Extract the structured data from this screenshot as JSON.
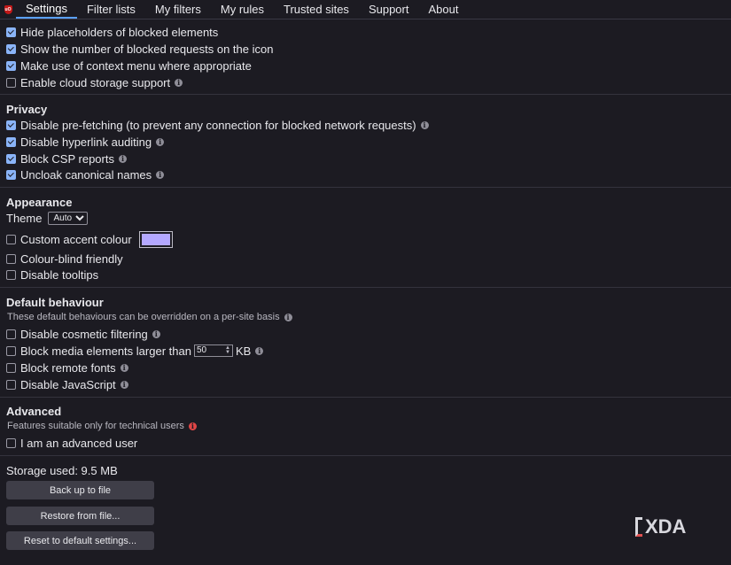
{
  "tabs": [
    "Settings",
    "Filter lists",
    "My filters",
    "My rules",
    "Trusted sites",
    "Support",
    "About"
  ],
  "active_tab": "Settings",
  "logo_text": "uO",
  "general": {
    "hide_placeholders": "Hide placeholders of blocked elements",
    "show_count": "Show the number of blocked requests on the icon",
    "context_menu": "Make use of context menu where appropriate",
    "cloud_storage": "Enable cloud storage support"
  },
  "privacy": {
    "title": "Privacy",
    "prefetch": "Disable pre-fetching (to prevent any connection for blocked network requests)",
    "hyperlink": "Disable hyperlink auditing",
    "csp": "Block CSP reports",
    "uncloak": "Uncloak canonical names"
  },
  "appearance": {
    "title": "Appearance",
    "theme_label": "Theme",
    "theme_value": "Auto",
    "accent": "Custom accent colour",
    "accent_color": "#b4a8ff",
    "colorblind": "Colour-blind friendly",
    "tooltips": "Disable tooltips"
  },
  "default_behaviour": {
    "title": "Default behaviour",
    "note": "These default behaviours can be overridden on a per-site basis",
    "cosmetic": "Disable cosmetic filtering",
    "media_prefix": "Block media elements larger than",
    "media_value": "50",
    "media_unit": "KB",
    "remote_fonts": "Block remote fonts",
    "javascript": "Disable JavaScript"
  },
  "advanced": {
    "title": "Advanced",
    "note": "Features suitable only for technical users",
    "advanced_user": "I am an advanced user"
  },
  "storage": "Storage used: 9.5 MB",
  "buttons": {
    "backup": "Back up to file",
    "restore": "Restore from file...",
    "reset": "Reset to default settings..."
  },
  "watermark": "XDA",
  "colors": {
    "background": "#1c1b22",
    "accent_check": "#8ab4f8",
    "active_tab": "#5aa0ff"
  }
}
